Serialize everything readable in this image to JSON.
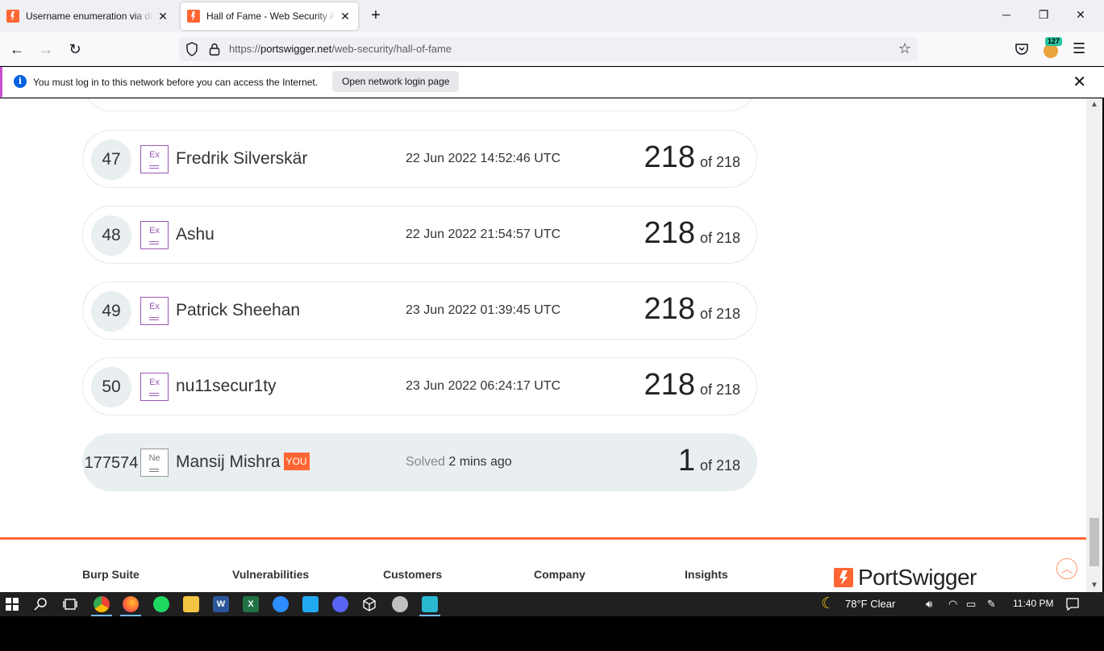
{
  "tabs": [
    {
      "title": "Username enumeration via diffe",
      "active": false
    },
    {
      "title": "Hall of Fame - Web Security Ac",
      "active": true
    }
  ],
  "nav": {
    "url_prefix": "https://",
    "url_host": "portswigger.net",
    "url_path": "/web-security/hall-of-fame",
    "extension_badge": "127"
  },
  "notification": {
    "message": "You must log in to this network before you can access the Internet.",
    "button": "Open network login page"
  },
  "leaderboard": [
    {
      "rank": "47",
      "avatar": "Ex",
      "name": "Fredrik Silverskär",
      "date": "22 Jun 2022 14:52:46 UTC",
      "solved": "218",
      "total": "of 218"
    },
    {
      "rank": "48",
      "avatar": "Ex",
      "name": "Ashu",
      "date": "22 Jun 2022 21:54:57 UTC",
      "solved": "218",
      "total": "of 218"
    },
    {
      "rank": "49",
      "avatar": "Ex",
      "name": "Patrick Sheehan",
      "date": "23 Jun 2022 01:39:45 UTC",
      "solved": "218",
      "total": "of 218"
    },
    {
      "rank": "50",
      "avatar": "Ex",
      "name": "nu11secur1ty",
      "date": "23 Jun 2022 06:24:17 UTC",
      "solved": "218",
      "total": "of 218"
    }
  ],
  "me": {
    "rank": "177574",
    "avatar": "Ne",
    "name": "Mansij Mishra",
    "you_badge": "YOU",
    "solved_label": "Solved",
    "solved_when": "2 mins ago",
    "solved": "1",
    "total": "of 218"
  },
  "footer": {
    "columns": [
      "Burp Suite",
      "Vulnerabilities",
      "Customers",
      "Company",
      "Insights"
    ],
    "brand": "PortSwigger"
  },
  "taskbar": {
    "weather": "78°F  Clear",
    "time": "11:40 PM"
  },
  "colors": {
    "accent": "#ff6633",
    "avatar_expert": "#9b59b6"
  }
}
